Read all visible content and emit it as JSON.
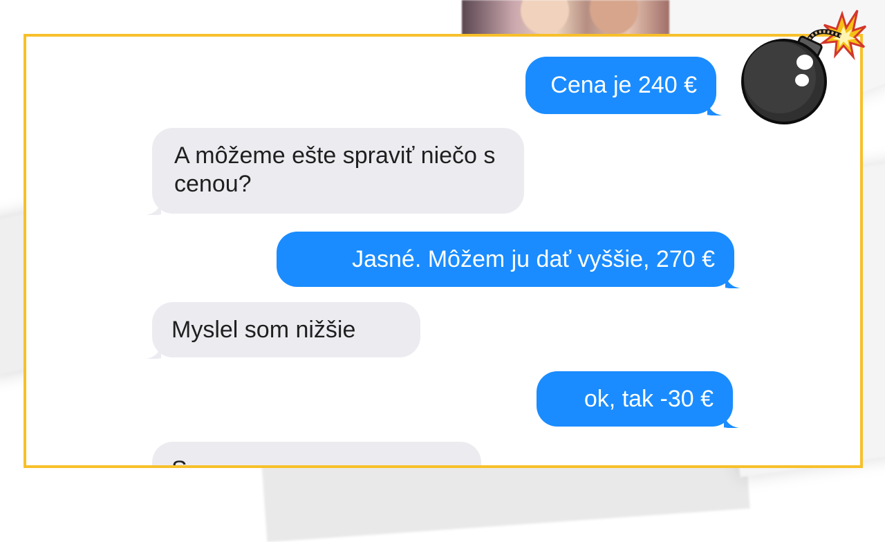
{
  "conversation": {
    "messages": [
      {
        "side": "out",
        "text": "Cena je 240 €"
      },
      {
        "side": "in",
        "text": "A môžeme ešte spraviť niečo s cenou?"
      },
      {
        "side": "out",
        "text": "Jasné. Môžem ju dať vyššie, 270 €"
      },
      {
        "side": "in",
        "text": "Myslel som nižšie"
      },
      {
        "side": "out",
        "text": "ok, tak -30 €"
      },
      {
        "side": "in",
        "text": "S"
      }
    ]
  },
  "colors": {
    "frame_border": "#f7c02a",
    "outgoing_bubble": "#1a8cff",
    "incoming_bubble": "#ecebf0"
  },
  "icons": {
    "corner_sticker": "bomb-icon"
  }
}
